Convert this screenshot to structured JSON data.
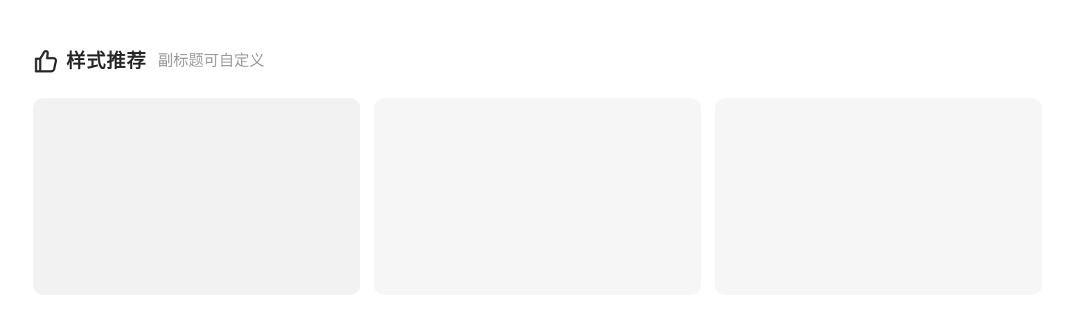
{
  "header": {
    "icon": "thumbs-up-icon",
    "title": "样式推荐",
    "subtitle": "副标题可自定义"
  },
  "cards": [
    {
      "background": "#f2f2f2"
    },
    {
      "background": "#f6f6f6"
    },
    {
      "background": "#f6f6f6"
    }
  ]
}
